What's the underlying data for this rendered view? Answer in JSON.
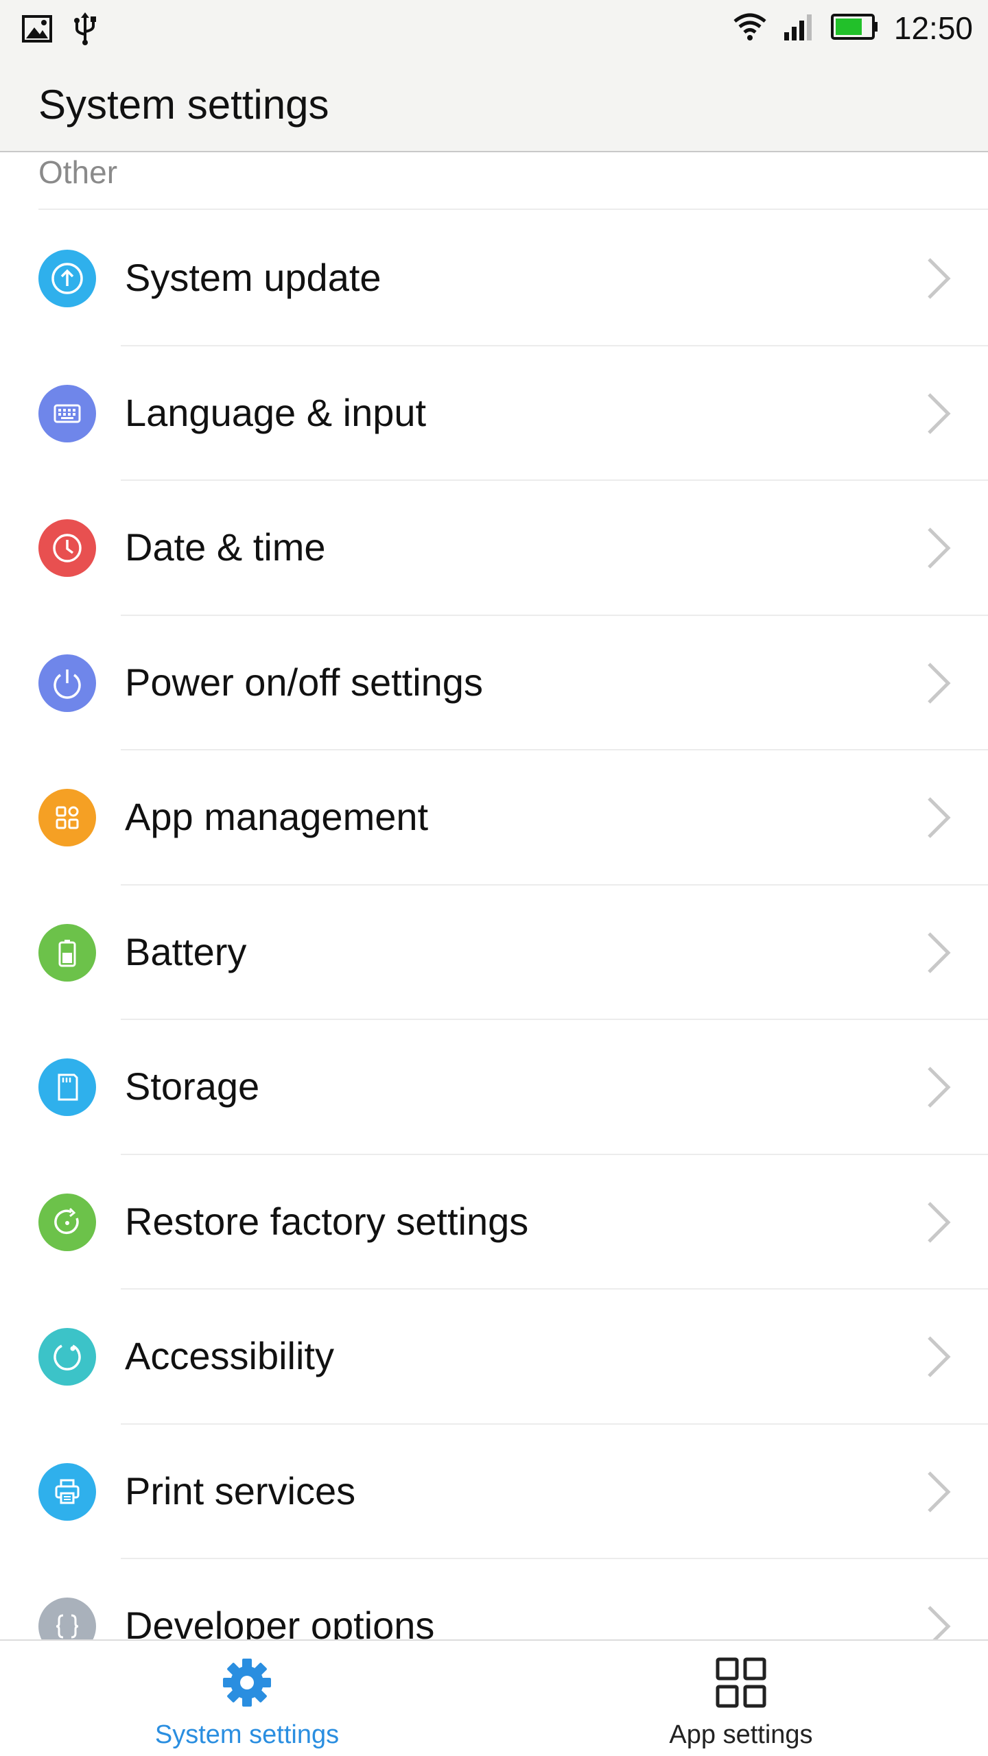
{
  "status_bar": {
    "time": "12:50",
    "left_icons": [
      "image-icon",
      "usb-icon"
    ],
    "right_icons": [
      "wifi-icon",
      "signal-icon",
      "battery-icon"
    ],
    "battery_color": "#22c02a"
  },
  "header": {
    "title": "System settings"
  },
  "section": {
    "title": "Other"
  },
  "items": [
    {
      "label": "System update",
      "icon": "system-update-icon",
      "color": "#2fb0ec"
    },
    {
      "label": "Language & input",
      "icon": "keyboard-icon",
      "color": "#6f86ea"
    },
    {
      "label": "Date & time",
      "icon": "clock-icon",
      "color": "#e85050"
    },
    {
      "label": "Power on/off settings",
      "icon": "power-icon",
      "color": "#6f86ea"
    },
    {
      "label": "App management",
      "icon": "apps-grid-icon",
      "color": "#f5a024"
    },
    {
      "label": "Battery",
      "icon": "battery-icon",
      "color": "#6cc24a"
    },
    {
      "label": "Storage",
      "icon": "sd-card-icon",
      "color": "#2fb0ec"
    },
    {
      "label": "Restore factory settings",
      "icon": "restore-icon",
      "color": "#6cc24a"
    },
    {
      "label": "Accessibility",
      "icon": "accessibility-icon",
      "color": "#3cc3c8"
    },
    {
      "label": "Print services",
      "icon": "printer-icon",
      "color": "#2fb0ec"
    },
    {
      "label": "Developer options",
      "icon": "braces-icon",
      "color": "#a9b1bb"
    }
  ],
  "bottom_nav": {
    "tabs": [
      {
        "label": "System settings",
        "icon": "gear-icon",
        "active": true,
        "color": "#2a8ee0"
      },
      {
        "label": "App settings",
        "icon": "grid-icon",
        "active": false,
        "color": "#222222"
      }
    ]
  }
}
